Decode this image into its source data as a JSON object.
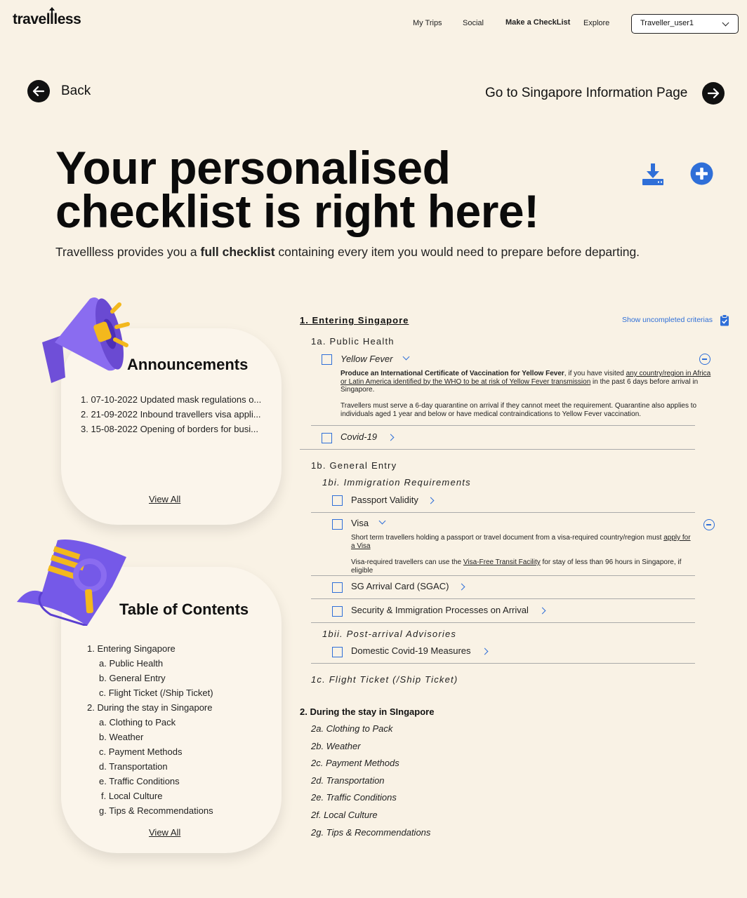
{
  "header": {
    "logo": "travellless",
    "nav": [
      "My Trips",
      "Social",
      "Make a CheckList",
      "Explore"
    ],
    "user": "Traveller_user1"
  },
  "navigation": {
    "back": "Back",
    "forward": "Go to Singapore Information Page"
  },
  "hero": {
    "title_line1": "Your personalised",
    "title_line2": "checklist is right here!",
    "subtitle_pre": "Travellless provides you a ",
    "subtitle_bold": "full checklist",
    "subtitle_post": " containing every item you would need to prepare before departing."
  },
  "announcements": {
    "title": "Announcements",
    "items": [
      "1. 07-10-2022 Updated mask regulations o...",
      "2. 21-09-2022 Inbound travellers visa appli...",
      "3. 15-08-2022 Opening of borders for busi..."
    ],
    "view_all": "View All"
  },
  "toc": {
    "title": "Table of Contents",
    "items": [
      "1. Entering Singapore",
      "a. Public Health",
      "b. General Entry",
      "c. Flight Ticket (/Ship Ticket)",
      "2. During the stay in Singapore",
      "a. Clothing to Pack",
      "b. Weather",
      "c. Payment Methods",
      "d. Transportation",
      "e. Traffic Conditions",
      "f. Local Culture",
      "g. Tips & Recommendations"
    ],
    "view_all": "View All"
  },
  "checklist": {
    "section1": "1. Entering Singapore",
    "show_uncompleted": "Show uncompleted criterias",
    "public_health": "1a. Public Health",
    "yellow_fever": "Yellow Fever",
    "yf_bold": "Produce an International Certificate of Vaccination for Yellow Fever",
    "yf_text1": ", if you have visited ",
    "yf_link": "any country/region in Africa or Latin America identified by the WHO to be at risk of Yellow Fever transmission",
    "yf_text2": " in the past 6 days before arrival in Singapore.",
    "yf_para2": "Travellers must serve a 6-day quarantine on arrival if they cannot meet the requirement. Quarantine also applies to individuals aged 1 year and below or have medical contraindications to Yellow Fever vaccination.",
    "covid": "Covid-19",
    "general_entry": "1b. General Entry",
    "immigration": "1bi. Immigration Requirements",
    "passport": "Passport Validity",
    "visa": "Visa",
    "visa_text1": "Short term travellers holding a passport or travel document from a visa-required country/region must ",
    "visa_link1": "apply for a Visa",
    "visa_text2": "Visa-required travellers can use the ",
    "visa_link2": "Visa-Free Transit Facility",
    "visa_text3": " for stay of less than 96 hours in Singapore, if eligible",
    "sgac": "SG Arrival Card (SGAC)",
    "security": "Security & Immigration Processes on Arrival",
    "post_arrival": "1bii. Post-arrival Advisories",
    "domestic": "Domestic Covid-19 Measures",
    "flight": "1c. Flight Ticket (/Ship Ticket)",
    "section2": "2. During the stay in SIngapore",
    "section2_items": [
      "2a. Clothing to Pack",
      "2b. Weather",
      "2c. Payment Methods",
      "2d. Transportation",
      "2e. Traffic Conditions",
      "2f. Local Culture",
      "2g. Tips & Recommendations"
    ]
  },
  "colors": {
    "background": "#f9f2e5",
    "accent": "#2f6fd8",
    "illustration": "#7b5ce6",
    "highlight": "#f3b81d"
  }
}
